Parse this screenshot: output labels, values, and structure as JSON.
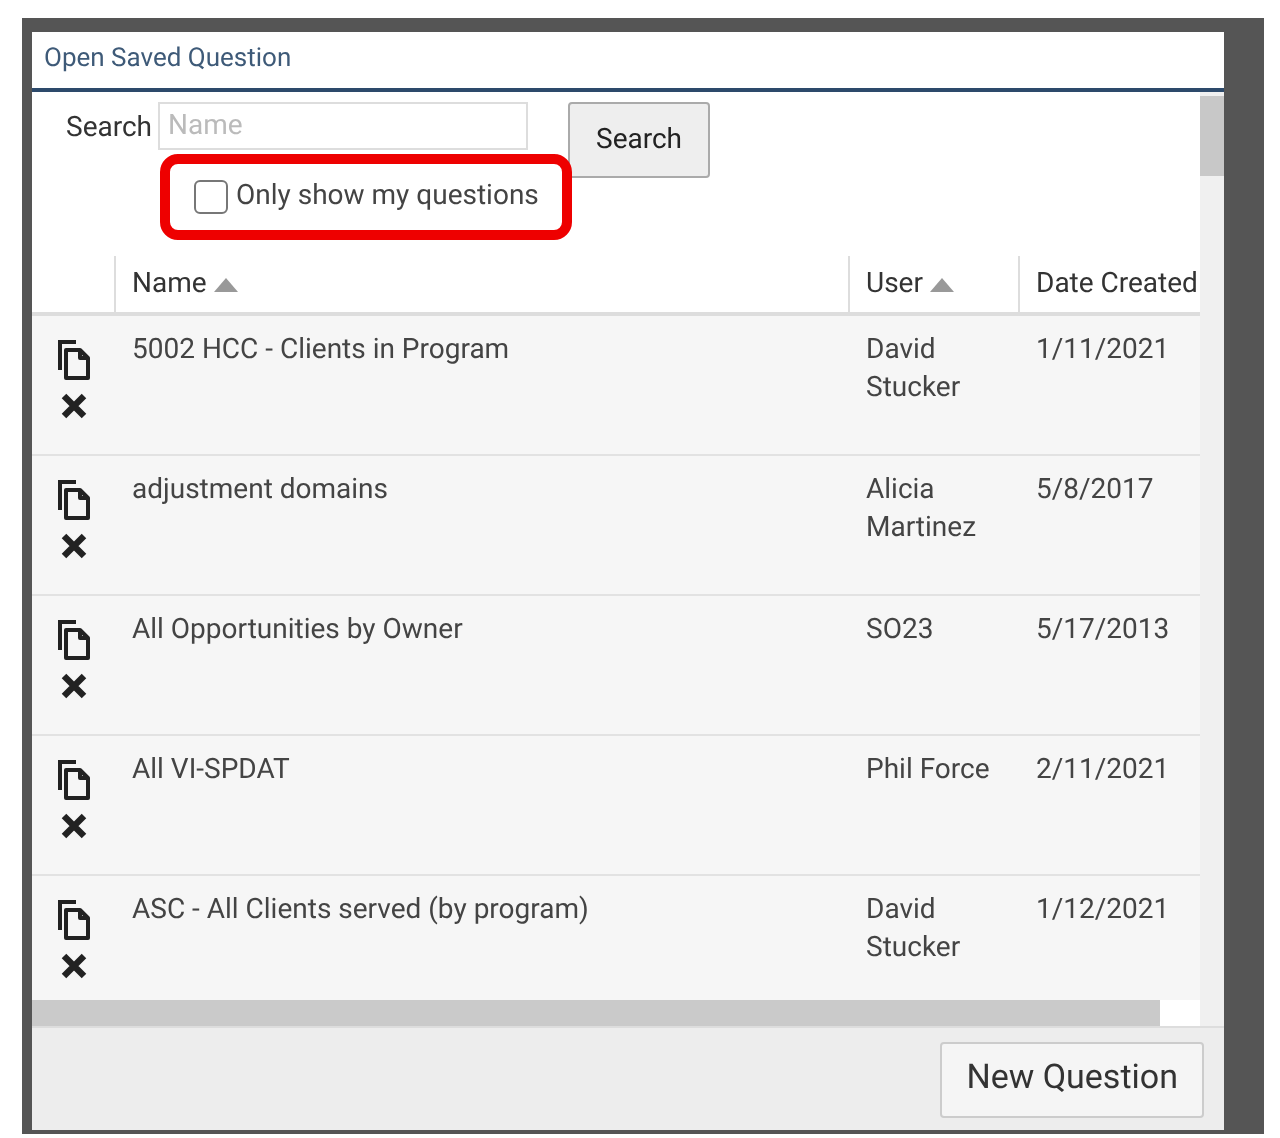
{
  "dialog": {
    "title": "Open Saved Question"
  },
  "search": {
    "label": "Search",
    "placeholder": "Name",
    "button": "Search"
  },
  "only_mine": {
    "label": "Only show my questions",
    "checked": false,
    "highlighted": true
  },
  "table": {
    "columns": [
      {
        "label": "Name",
        "sorted": true
      },
      {
        "label": "User",
        "sorted": true
      },
      {
        "label": "Date Created",
        "sorted": false
      }
    ],
    "rows": [
      {
        "name": "5002 HCC - Clients in Program",
        "user": "David Stucker",
        "date": "1/11/2021"
      },
      {
        "name": "adjustment domains",
        "user": "Alicia Martinez",
        "date": "5/8/2017"
      },
      {
        "name": "All Opportunities by Owner",
        "user": "SO23",
        "date": "5/17/2013"
      },
      {
        "name": "All VI-SPDAT",
        "user": "Phil Force",
        "date": "2/11/2021"
      },
      {
        "name": "ASC - All Clients served (by program)",
        "user": "David Stucker",
        "date": "1/12/2021"
      }
    ]
  },
  "footer": {
    "button": "New Question"
  }
}
